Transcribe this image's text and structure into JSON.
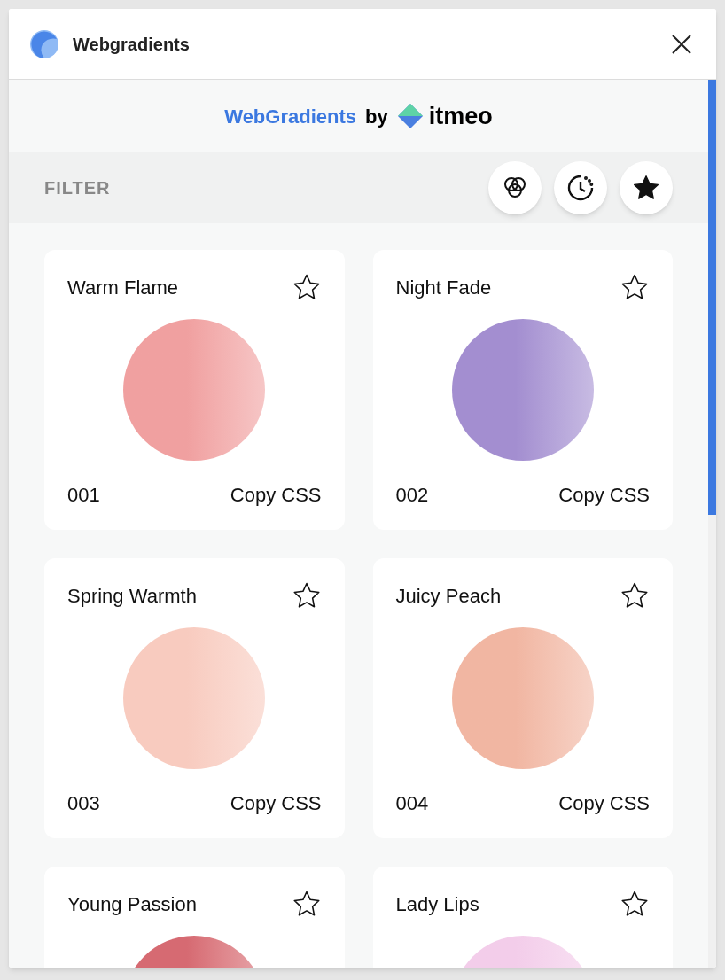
{
  "window": {
    "title": "Webgradients"
  },
  "brand": {
    "name": "WebGradients",
    "by": "by",
    "company": "itmeo"
  },
  "filter": {
    "label": "FILTER"
  },
  "gradients": [
    {
      "name": "Warm Flame",
      "number": "001",
      "copy_label": "Copy CSS",
      "favorite": false,
      "color": "#f0a0a0"
    },
    {
      "name": "Night Fade",
      "number": "002",
      "copy_label": "Copy CSS",
      "favorite": false,
      "color": "#a38ed0"
    },
    {
      "name": "Spring Warmth",
      "number": "003",
      "copy_label": "Copy CSS",
      "favorite": false,
      "color": "#f8cbbf"
    },
    {
      "name": "Juicy Peach",
      "number": "004",
      "copy_label": "Copy CSS",
      "favorite": false,
      "color": "#f1b6a2"
    },
    {
      "name": "Young Passion",
      "favorite": false,
      "color": "#d66a72"
    },
    {
      "name": "Lady Lips",
      "favorite": false,
      "color": "#f3cdea"
    }
  ]
}
